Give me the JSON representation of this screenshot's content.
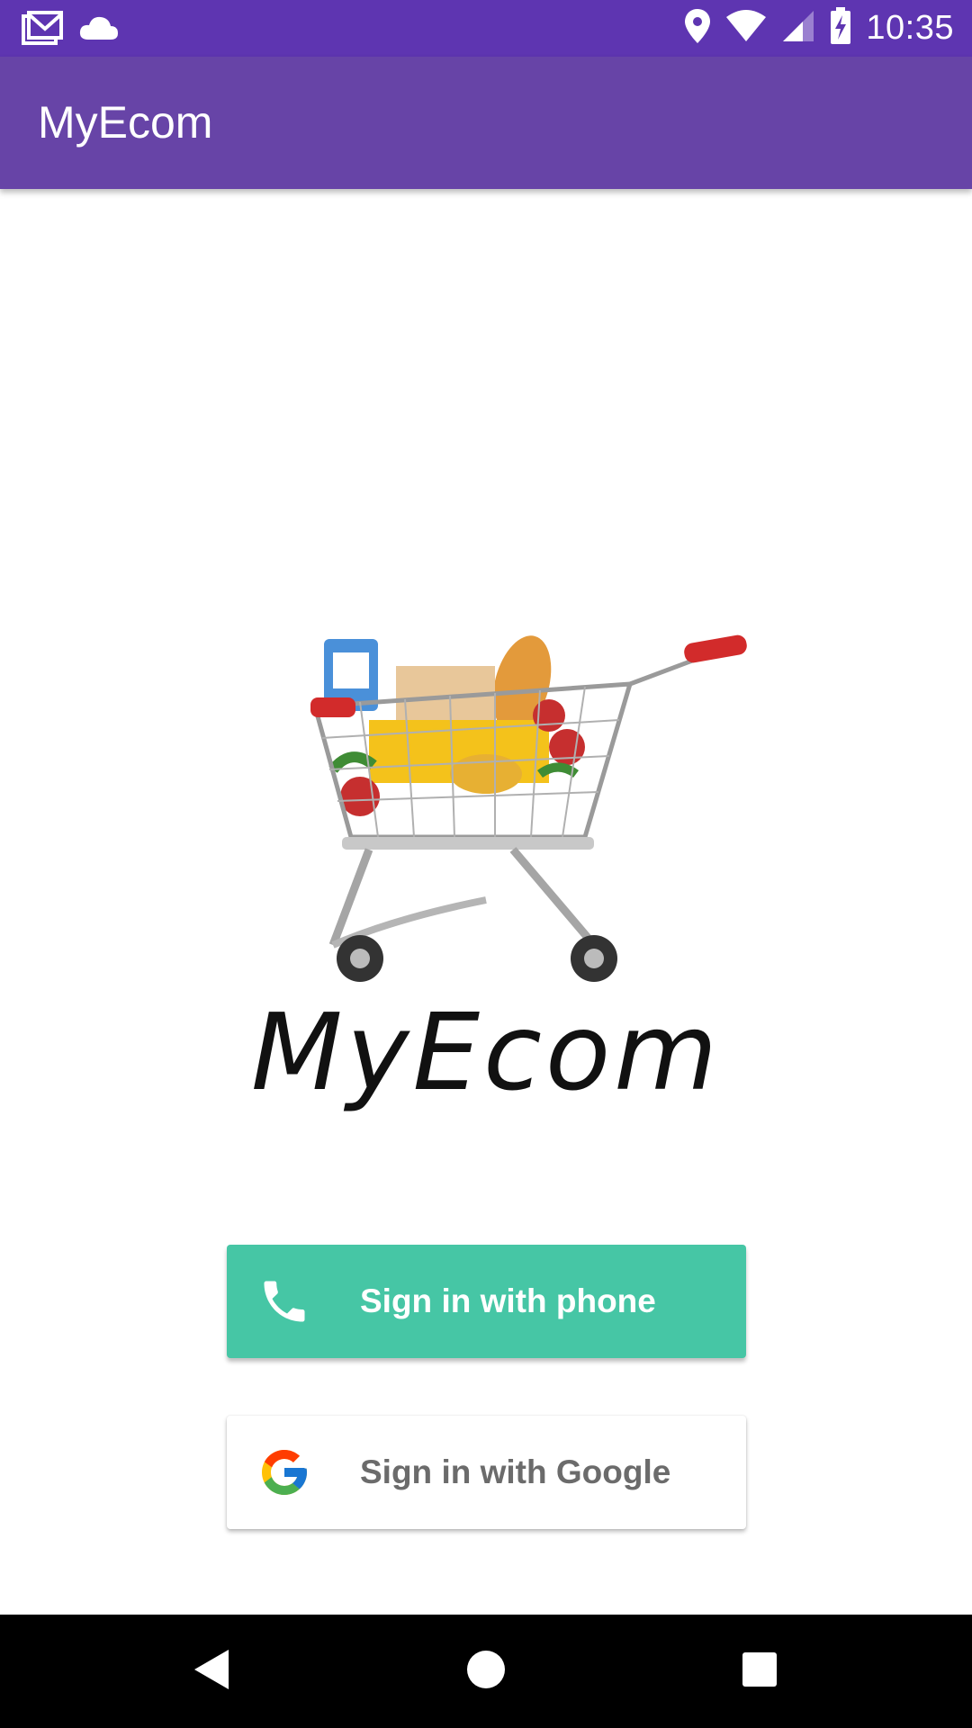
{
  "status_bar": {
    "time": "10:35",
    "left_icons": [
      "gmail-icon",
      "cloud-icon"
    ],
    "right_icons": [
      "location-icon",
      "wifi-icon",
      "signal-icon",
      "battery-charging-icon"
    ]
  },
  "app_bar": {
    "title": "MyEcom"
  },
  "logo": {
    "wordmark": "MyEcom",
    "icon": "shopping-cart-icon"
  },
  "buttons": {
    "phone": {
      "label": "Sign in with phone",
      "icon": "phone-icon",
      "color": "#46c6a5"
    },
    "google": {
      "label": "Sign in with Google",
      "icon": "google-icon",
      "color": "#ffffff"
    }
  },
  "nav_bar": {
    "icons": [
      "back-icon",
      "home-icon",
      "recents-icon"
    ]
  },
  "colors": {
    "status_bar": "#5e35b1",
    "app_bar": "#6744a7",
    "accent": "#46c6a5"
  }
}
